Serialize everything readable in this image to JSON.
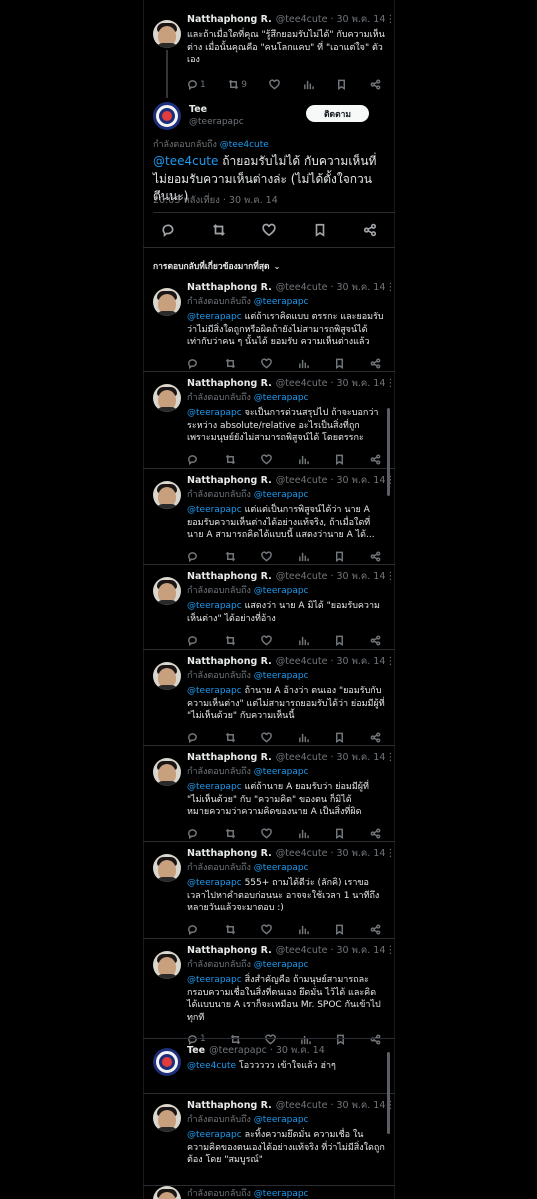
{
  "top_tweet": {
    "name": "Natthaphong R.",
    "handle": "@tee4cute",
    "sep": "·",
    "date": "30 พ.ค. 14",
    "text": "และถ้าเมื่อใดที่คุณ \"รู้สึกยอมรับไม่ได้\" กับความเห็นต่าง เมื่อนั้นคุณคือ \"คนโลกแคบ\" ที่ \"เอาแต่ใจ\" ตัวเอง",
    "reply_count": "1",
    "retweet_count": "9"
  },
  "main_tweet": {
    "name": "Tee",
    "handle": "@teerapapc",
    "follow_label": "ติดตาม",
    "replying_prefix": "กำลังตอบกลับถึง",
    "replying_to": "@tee4cute",
    "mention": "@tee4cute",
    "text": " ถ้ายอมรับไม่ได้ กับความเห็นที่ไม่ยอมรับความเห็นต่างล่ะ (ไม่ได้ตั้งใจกวนตีนนะ)",
    "timestamp": "20:03 หลังเที่ยง · 30 พ.ค. 14"
  },
  "sort_label": "การตอบกลับที่เกี่ยวข้องมากที่สุด",
  "replies": [
    {
      "name": "Natthaphong R.",
      "handle": "@tee4cute",
      "date": "30 พ.ค. 14",
      "replying_prefix": "กำลังตอบกลับถึง",
      "replying_to": "@teerapapc",
      "mention": "@teerapapc",
      "text": " แต่ถ้าเราคิดแบบ ตรรกะ และยอมรับว่าไม่มีสิ่งใดถูกหรือผิดถ้ายังไม่สามารถพิสูจน์ได้ เท่ากับว่าคน ๆ นั้นได้ ยอมรับ ความเห็นต่างแล้ว",
      "reply_count": "",
      "retweet_count": ""
    },
    {
      "name": "Natthaphong R.",
      "handle": "@tee4cute",
      "date": "30 พ.ค. 14",
      "replying_prefix": "กำลังตอบกลับถึง",
      "replying_to": "@teerapapc",
      "mention": "@teerapapc",
      "text": " จะเป็นการด่วนสรุปไป ถ้าจะบอกว่าระหว่าง absolute/relative อะไรเป็นสิ่งที่ถูก เพราะมนุษย์ยังไม่สามารถพิสูจน์ได้ โดยตรรกะ",
      "reply_count": "",
      "retweet_count": ""
    },
    {
      "name": "Natthaphong R.",
      "handle": "@tee4cute",
      "date": "30 พ.ค. 14",
      "replying_prefix": "กำลังตอบกลับถึง",
      "replying_to": "@teerapapc",
      "mention": "@teerapapc",
      "text": " แต่แต่เป็นการพิสูจน์ได้ว่า นาย A ยอมรับความเห็นต่างได้อย่างแท้จริง, ถ้าเมื่อใดที่นาย A สามารถคิดได้แบบนี้ แสดงว่านาย A ได้...",
      "reply_count": "",
      "retweet_count": ""
    },
    {
      "name": "Natthaphong R.",
      "handle": "@tee4cute",
      "date": "30 พ.ค. 14",
      "replying_prefix": "กำลังตอบกลับถึง",
      "replying_to": "@teerapapc",
      "mention": "@teerapapc",
      "text": " แสดงว่า นาย A มิได้ \"ยอมรับความเห็นต่าง\" ได้อย่างที่อ้าง",
      "reply_count": "",
      "retweet_count": ""
    },
    {
      "name": "Natthaphong R.",
      "handle": "@tee4cute",
      "date": "30 พ.ค. 14",
      "replying_prefix": "กำลังตอบกลับถึง",
      "replying_to": "@teerapapc",
      "mention": "@teerapapc",
      "text": " ถ้านาย A อ้างว่า ตนเอง \"ยอมรับกับความเห็นต่าง\" แต่ไม่สามารถยอมรับได้ว่า ย่อมมีผู้ที่ \"ไม่เห็นด้วย\" กับความเห็นนี้",
      "reply_count": "",
      "retweet_count": ""
    },
    {
      "name": "Natthaphong R.",
      "handle": "@tee4cute",
      "date": "30 พ.ค. 14",
      "replying_prefix": "กำลังตอบกลับถึง",
      "replying_to": "@teerapapc",
      "mention": "@teerapapc",
      "text": " แต่ถ้านาย A ยอมรับว่า ย่อมมีผู้ที่ \"ไม่เห็นด้วย\" กับ \"ความคิด\" ของตน ก็มิได้หมายความว่าความคิดของนาย A เป็นสิ่งที่ผิด",
      "reply_count": "",
      "retweet_count": ""
    },
    {
      "name": "Natthaphong R.",
      "handle": "@tee4cute",
      "date": "30 พ.ค. 14",
      "replying_prefix": "กำลังตอบกลับถึง",
      "replying_to": "@teerapapc",
      "mention": "@teerapapc",
      "text": " 555+ ถามได้ดีว่ะ (ลักคิ) เราขอเวลาไปหาคำตอบก่อนนะ อาจจะใช้เวลา 1 นาทีถึง หลายวันแล้วจะมาตอบ :)",
      "reply_count": "",
      "retweet_count": ""
    },
    {
      "name": "Natthaphong R.",
      "handle": "@tee4cute",
      "date": "30 พ.ค. 14",
      "replying_prefix": "กำลังตอบกลับถึง",
      "replying_to": "@teerapapc",
      "mention": "@teerapapc",
      "text": " สิ่งสำคัญคือ ถ้ามนุษย์สามารถละกรอบความเชื่อในสิ่งที่ตนเอง ยึดมั่น ไว้ได้ และคิดได้แบบนาย A เราก็จะเหมือน Mr. SPOC กันเข้าไปทุกที",
      "reply_count": "1",
      "retweet_count": ""
    }
  ],
  "tee_reply": {
    "name": "Tee",
    "handle": "@teerapapc",
    "date": "30 พ.ค. 14",
    "mention": "@tee4cute",
    "text": " โอววววว เข้าใจแล้ว ฮ่าๆ"
  },
  "last_reply": {
    "name": "Natthaphong R.",
    "handle": "@tee4cute",
    "date": "30 พ.ค. 14",
    "replying_prefix": "กำลังตอบกลับถึง",
    "replying_to": "@teerapapc",
    "mention": "@teerapapc",
    "text": " ละทิ้งความยึดมั่น ความเชื่อ ในความคิดของตนเองได้อย่างแท้จริง ที่ว่าไม่มีสิ่งใดถูกต้อง โดย \"สมบูรณ์\""
  },
  "cut_reply": {
    "replying_prefix": "กำลังตอบกลับถึง",
    "replying_to": "@teerapapc"
  },
  "sep": "·",
  "more": "⋮"
}
